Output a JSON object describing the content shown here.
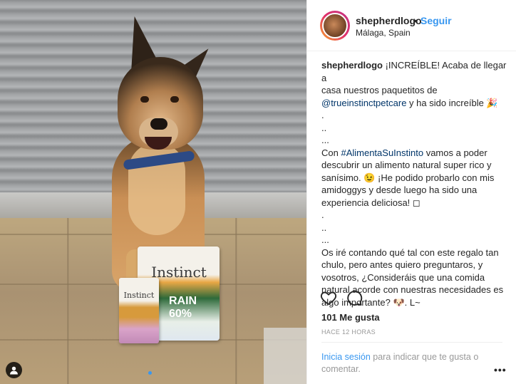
{
  "header": {
    "username": "shepherdlogo",
    "separator": "•",
    "follow_label": "Seguir",
    "location": "Málaga, Spain"
  },
  "photo": {
    "package_brand": "Instinct",
    "package_tag": "RAIN 60%",
    "pouch_brand": "Instinct"
  },
  "caption": {
    "username": "shepherdlogo",
    "line1": "¡INCREÍBLE! Acaba de llegar a",
    "line2": "casa nuestros paquetitos de",
    "mention": "@trueinstinctpetcare",
    "line3_rest": " y ha sido increíble 🎉",
    "dot1": ".",
    "dot2": "..",
    "dot3": "...",
    "line4_pre": "Con ",
    "hashtag": "#AlimentaSuInstinto",
    "line4_post": " vamos a poder",
    "line5": "descubrir un alimento natural super rico y",
    "line6": "sanísimo. 😉 ¡He podido probarlo con mis",
    "line7": "amidoggys y desde luego ha sido una",
    "line8": "experiencia deliciosa! ◻",
    "dot4": ".",
    "dot5": "..",
    "dot6": "...",
    "line9": "Os iré contando qué tal con este regalo tan",
    "line10": "chulo, pero antes quiero preguntaros, y",
    "line11": "vosotros, ¿Consideráis que una comida",
    "line12": "natural acorde con nuestras necesidades es",
    "line13": "algo importante? 🐶. L~"
  },
  "stats": {
    "likes": "101 Me gusta",
    "time": "HACE 12 HORAS"
  },
  "footer": {
    "login_link": "Inicia sesión",
    "login_rest": " para indicar que te gusta o comentar.",
    "more": "•••"
  },
  "icons": {
    "heart": "heart-icon",
    "comment": "comment-icon",
    "user_tag": "user-tag-icon",
    "more": "more-options-icon"
  },
  "colors": {
    "link": "#3897f0",
    "mention": "#003569",
    "muted": "#999999",
    "text": "#262626"
  }
}
